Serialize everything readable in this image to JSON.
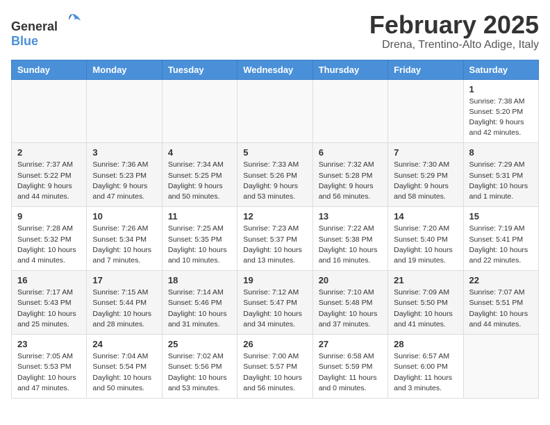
{
  "header": {
    "logo_general": "General",
    "logo_blue": "Blue",
    "month_title": "February 2025",
    "location": "Drena, Trentino-Alto Adige, Italy"
  },
  "weekdays": [
    "Sunday",
    "Monday",
    "Tuesday",
    "Wednesday",
    "Thursday",
    "Friday",
    "Saturday"
  ],
  "weeks": [
    [
      {
        "day": "",
        "info": ""
      },
      {
        "day": "",
        "info": ""
      },
      {
        "day": "",
        "info": ""
      },
      {
        "day": "",
        "info": ""
      },
      {
        "day": "",
        "info": ""
      },
      {
        "day": "",
        "info": ""
      },
      {
        "day": "1",
        "info": "Sunrise: 7:38 AM\nSunset: 5:20 PM\nDaylight: 9 hours and 42 minutes."
      }
    ],
    [
      {
        "day": "2",
        "info": "Sunrise: 7:37 AM\nSunset: 5:22 PM\nDaylight: 9 hours and 44 minutes."
      },
      {
        "day": "3",
        "info": "Sunrise: 7:36 AM\nSunset: 5:23 PM\nDaylight: 9 hours and 47 minutes."
      },
      {
        "day": "4",
        "info": "Sunrise: 7:34 AM\nSunset: 5:25 PM\nDaylight: 9 hours and 50 minutes."
      },
      {
        "day": "5",
        "info": "Sunrise: 7:33 AM\nSunset: 5:26 PM\nDaylight: 9 hours and 53 minutes."
      },
      {
        "day": "6",
        "info": "Sunrise: 7:32 AM\nSunset: 5:28 PM\nDaylight: 9 hours and 56 minutes."
      },
      {
        "day": "7",
        "info": "Sunrise: 7:30 AM\nSunset: 5:29 PM\nDaylight: 9 hours and 58 minutes."
      },
      {
        "day": "8",
        "info": "Sunrise: 7:29 AM\nSunset: 5:31 PM\nDaylight: 10 hours and 1 minute."
      }
    ],
    [
      {
        "day": "9",
        "info": "Sunrise: 7:28 AM\nSunset: 5:32 PM\nDaylight: 10 hours and 4 minutes."
      },
      {
        "day": "10",
        "info": "Sunrise: 7:26 AM\nSunset: 5:34 PM\nDaylight: 10 hours and 7 minutes."
      },
      {
        "day": "11",
        "info": "Sunrise: 7:25 AM\nSunset: 5:35 PM\nDaylight: 10 hours and 10 minutes."
      },
      {
        "day": "12",
        "info": "Sunrise: 7:23 AM\nSunset: 5:37 PM\nDaylight: 10 hours and 13 minutes."
      },
      {
        "day": "13",
        "info": "Sunrise: 7:22 AM\nSunset: 5:38 PM\nDaylight: 10 hours and 16 minutes."
      },
      {
        "day": "14",
        "info": "Sunrise: 7:20 AM\nSunset: 5:40 PM\nDaylight: 10 hours and 19 minutes."
      },
      {
        "day": "15",
        "info": "Sunrise: 7:19 AM\nSunset: 5:41 PM\nDaylight: 10 hours and 22 minutes."
      }
    ],
    [
      {
        "day": "16",
        "info": "Sunrise: 7:17 AM\nSunset: 5:43 PM\nDaylight: 10 hours and 25 minutes."
      },
      {
        "day": "17",
        "info": "Sunrise: 7:15 AM\nSunset: 5:44 PM\nDaylight: 10 hours and 28 minutes."
      },
      {
        "day": "18",
        "info": "Sunrise: 7:14 AM\nSunset: 5:46 PM\nDaylight: 10 hours and 31 minutes."
      },
      {
        "day": "19",
        "info": "Sunrise: 7:12 AM\nSunset: 5:47 PM\nDaylight: 10 hours and 34 minutes."
      },
      {
        "day": "20",
        "info": "Sunrise: 7:10 AM\nSunset: 5:48 PM\nDaylight: 10 hours and 37 minutes."
      },
      {
        "day": "21",
        "info": "Sunrise: 7:09 AM\nSunset: 5:50 PM\nDaylight: 10 hours and 41 minutes."
      },
      {
        "day": "22",
        "info": "Sunrise: 7:07 AM\nSunset: 5:51 PM\nDaylight: 10 hours and 44 minutes."
      }
    ],
    [
      {
        "day": "23",
        "info": "Sunrise: 7:05 AM\nSunset: 5:53 PM\nDaylight: 10 hours and 47 minutes."
      },
      {
        "day": "24",
        "info": "Sunrise: 7:04 AM\nSunset: 5:54 PM\nDaylight: 10 hours and 50 minutes."
      },
      {
        "day": "25",
        "info": "Sunrise: 7:02 AM\nSunset: 5:56 PM\nDaylight: 10 hours and 53 minutes."
      },
      {
        "day": "26",
        "info": "Sunrise: 7:00 AM\nSunset: 5:57 PM\nDaylight: 10 hours and 56 minutes."
      },
      {
        "day": "27",
        "info": "Sunrise: 6:58 AM\nSunset: 5:59 PM\nDaylight: 11 hours and 0 minutes."
      },
      {
        "day": "28",
        "info": "Sunrise: 6:57 AM\nSunset: 6:00 PM\nDaylight: 11 hours and 3 minutes."
      },
      {
        "day": "",
        "info": ""
      }
    ]
  ]
}
